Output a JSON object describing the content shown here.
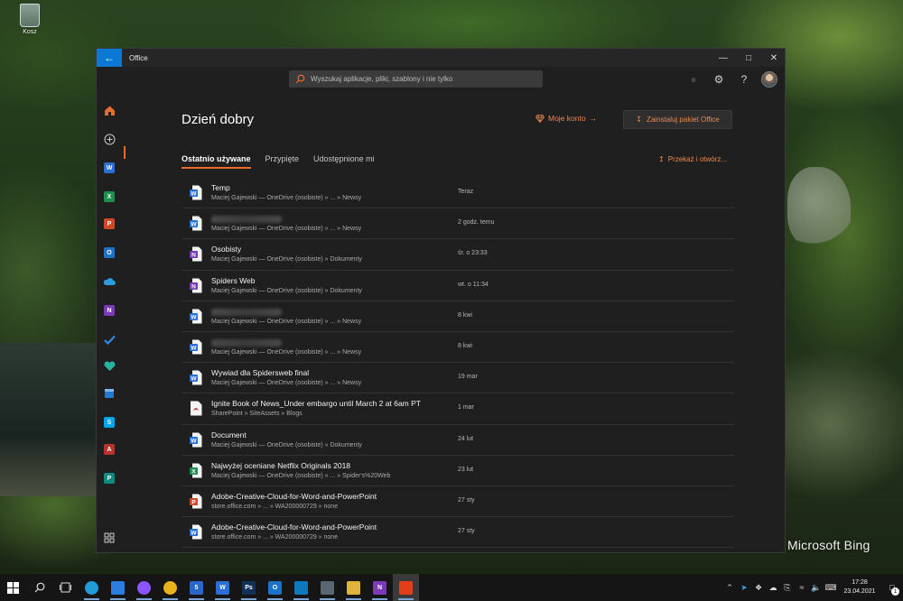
{
  "desktop": {
    "recycle_bin_label": "Kosz",
    "watermark": "Microsoft Bing"
  },
  "window": {
    "title": "Office",
    "controls": [
      "minimize",
      "maximize",
      "close"
    ]
  },
  "search": {
    "placeholder": "Wyszukaj aplikacje, pliki, szablony i nie tylko"
  },
  "header": {
    "greeting": "Dzień dobry",
    "account_link": "Moje konto",
    "install_button": "Zainstaluj pakiet Office",
    "upload_link": "Przekaż i otwórz..."
  },
  "tabs": [
    {
      "label": "Ostatnio używane",
      "active": true
    },
    {
      "label": "Przypięte",
      "active": false
    },
    {
      "label": "Udostępnione mi",
      "active": false
    }
  ],
  "rail": [
    {
      "name": "home",
      "color": "#e86c2a"
    },
    {
      "name": "create",
      "color": "#cccccc"
    },
    {
      "name": "word",
      "letter": "W",
      "color": "#2b6fd6"
    },
    {
      "name": "excel",
      "letter": "X",
      "color": "#1e8e4e"
    },
    {
      "name": "powerpoint",
      "letter": "P",
      "color": "#d24726"
    },
    {
      "name": "outlook",
      "letter": "O",
      "color": "#1a73c9"
    },
    {
      "name": "onedrive",
      "color": "#2d9be0"
    },
    {
      "name": "onenote",
      "letter": "N",
      "color": "#7b3ab8"
    },
    {
      "name": "todo",
      "color": "#2f8be6"
    },
    {
      "name": "family-safety",
      "color": "#27b2a0"
    },
    {
      "name": "calendar",
      "color": "#1f7ad6"
    },
    {
      "name": "skype",
      "letter": "S",
      "color": "#00a4ef"
    },
    {
      "name": "access",
      "letter": "A",
      "color": "#b7332b"
    },
    {
      "name": "publisher",
      "letter": "P",
      "color": "#0f8a7e"
    },
    {
      "name": "all-apps",
      "color": "#cccccc"
    }
  ],
  "files": [
    {
      "name": "Temp",
      "path": "Maciej Gajewski — OneDrive (osobiste) » ... » Newsy",
      "date": "Teraz",
      "type": "word",
      "blurred": false
    },
    {
      "name": "",
      "path": "Maciej Gajewski — OneDrive (osobiste) » ... » Newsy",
      "date": "2 godz. temu",
      "type": "word",
      "blurred": true
    },
    {
      "name": "Osobisty",
      "path": "Maciej Gajewski — OneDrive (osobiste) » Dokumenty",
      "date": "śr. o 23:33",
      "type": "onenote",
      "blurred": false
    },
    {
      "name": "Spiders Web",
      "path": "Maciej Gajewski — OneDrive (osobiste) » Dokumenty",
      "date": "wt. o 11:34",
      "type": "onenote",
      "blurred": false
    },
    {
      "name": "",
      "path": "Maciej Gajewski — OneDrive (osobiste) » ... » Newsy",
      "date": "8 kwi",
      "type": "word",
      "blurred": true
    },
    {
      "name": "",
      "path": "Maciej Gajewski — OneDrive (osobiste) » ... » Newsy",
      "date": "8 kwi",
      "type": "word",
      "blurred": true
    },
    {
      "name": "Wywiad dla Spidersweb final",
      "path": "Maciej Gajewski — OneDrive (osobiste) » ... » Newsy",
      "date": "19 mar",
      "type": "word",
      "blurred": false
    },
    {
      "name": "Ignite Book of News_Under embargo until March 2 at 6am PT",
      "path": "SharePoint » SiteAssets » Blogs",
      "date": "1 mar",
      "type": "pdf",
      "blurred": false
    },
    {
      "name": "Document",
      "path": "Maciej Gajewski — OneDrive (osobiste) » Dokumenty",
      "date": "24 lut",
      "type": "word",
      "blurred": false
    },
    {
      "name": "Najwyżej oceniane Netflix Originals 2018",
      "path": "Maciej Gajewski — OneDrive (osobiste) » ... » Spider's%20Web",
      "date": "23 lut",
      "type": "excel",
      "blurred": false
    },
    {
      "name": "Adobe-Creative-Cloud-for-Word-and-PowerPoint",
      "path": "store.office.com » ... » WA200000729 » none",
      "date": "27 sty",
      "type": "powerpoint",
      "blurred": false
    },
    {
      "name": "Adobe-Creative-Cloud-for-Word-and-PowerPoint",
      "path": "store.office.com » ... » WA200000729 » none",
      "date": "27 sty",
      "type": "word",
      "blurred": false
    }
  ],
  "file_colors": {
    "word": "#2b6fd6",
    "excel": "#1e8e4e",
    "powerpoint": "#d24726",
    "onenote": "#7b3ab8",
    "pdf": "#d13438"
  },
  "taskbar": {
    "apps": [
      {
        "name": "start",
        "label": ""
      },
      {
        "name": "search",
        "label": ""
      },
      {
        "name": "task-view",
        "label": ""
      },
      {
        "name": "edge",
        "label": "",
        "color": "#1f9cd8",
        "on": true
      },
      {
        "name": "mail",
        "label": "",
        "color": "#2a7de1",
        "on": true
      },
      {
        "name": "messenger",
        "label": "",
        "color": "#8a54ff",
        "on": true
      },
      {
        "name": "chrome",
        "label": "",
        "color": "#e8b21b",
        "on": true
      },
      {
        "name": "tasks",
        "label": "5",
        "color": "#2a66c9",
        "on": true
      },
      {
        "name": "word",
        "label": "W",
        "color": "#2b6fd6",
        "on": true
      },
      {
        "name": "photoshop",
        "label": "Ps",
        "color": "#12315a",
        "on": true
      },
      {
        "name": "outlook",
        "label": "O",
        "color": "#1a73c9",
        "on": true
      },
      {
        "name": "trello",
        "label": "",
        "color": "#0f79bf",
        "on": true
      },
      {
        "name": "calculator",
        "label": "",
        "color": "#5b6770",
        "on": true
      },
      {
        "name": "explorer",
        "label": "",
        "color": "#e2b33a",
        "on": true
      },
      {
        "name": "onenote",
        "label": "N",
        "color": "#7b3ab8",
        "on": true
      },
      {
        "name": "office",
        "label": "",
        "color": "#e23e1e",
        "on": true,
        "focus": true
      }
    ],
    "time": "17:28",
    "date": "23.04.2021",
    "notification_count": "1"
  }
}
